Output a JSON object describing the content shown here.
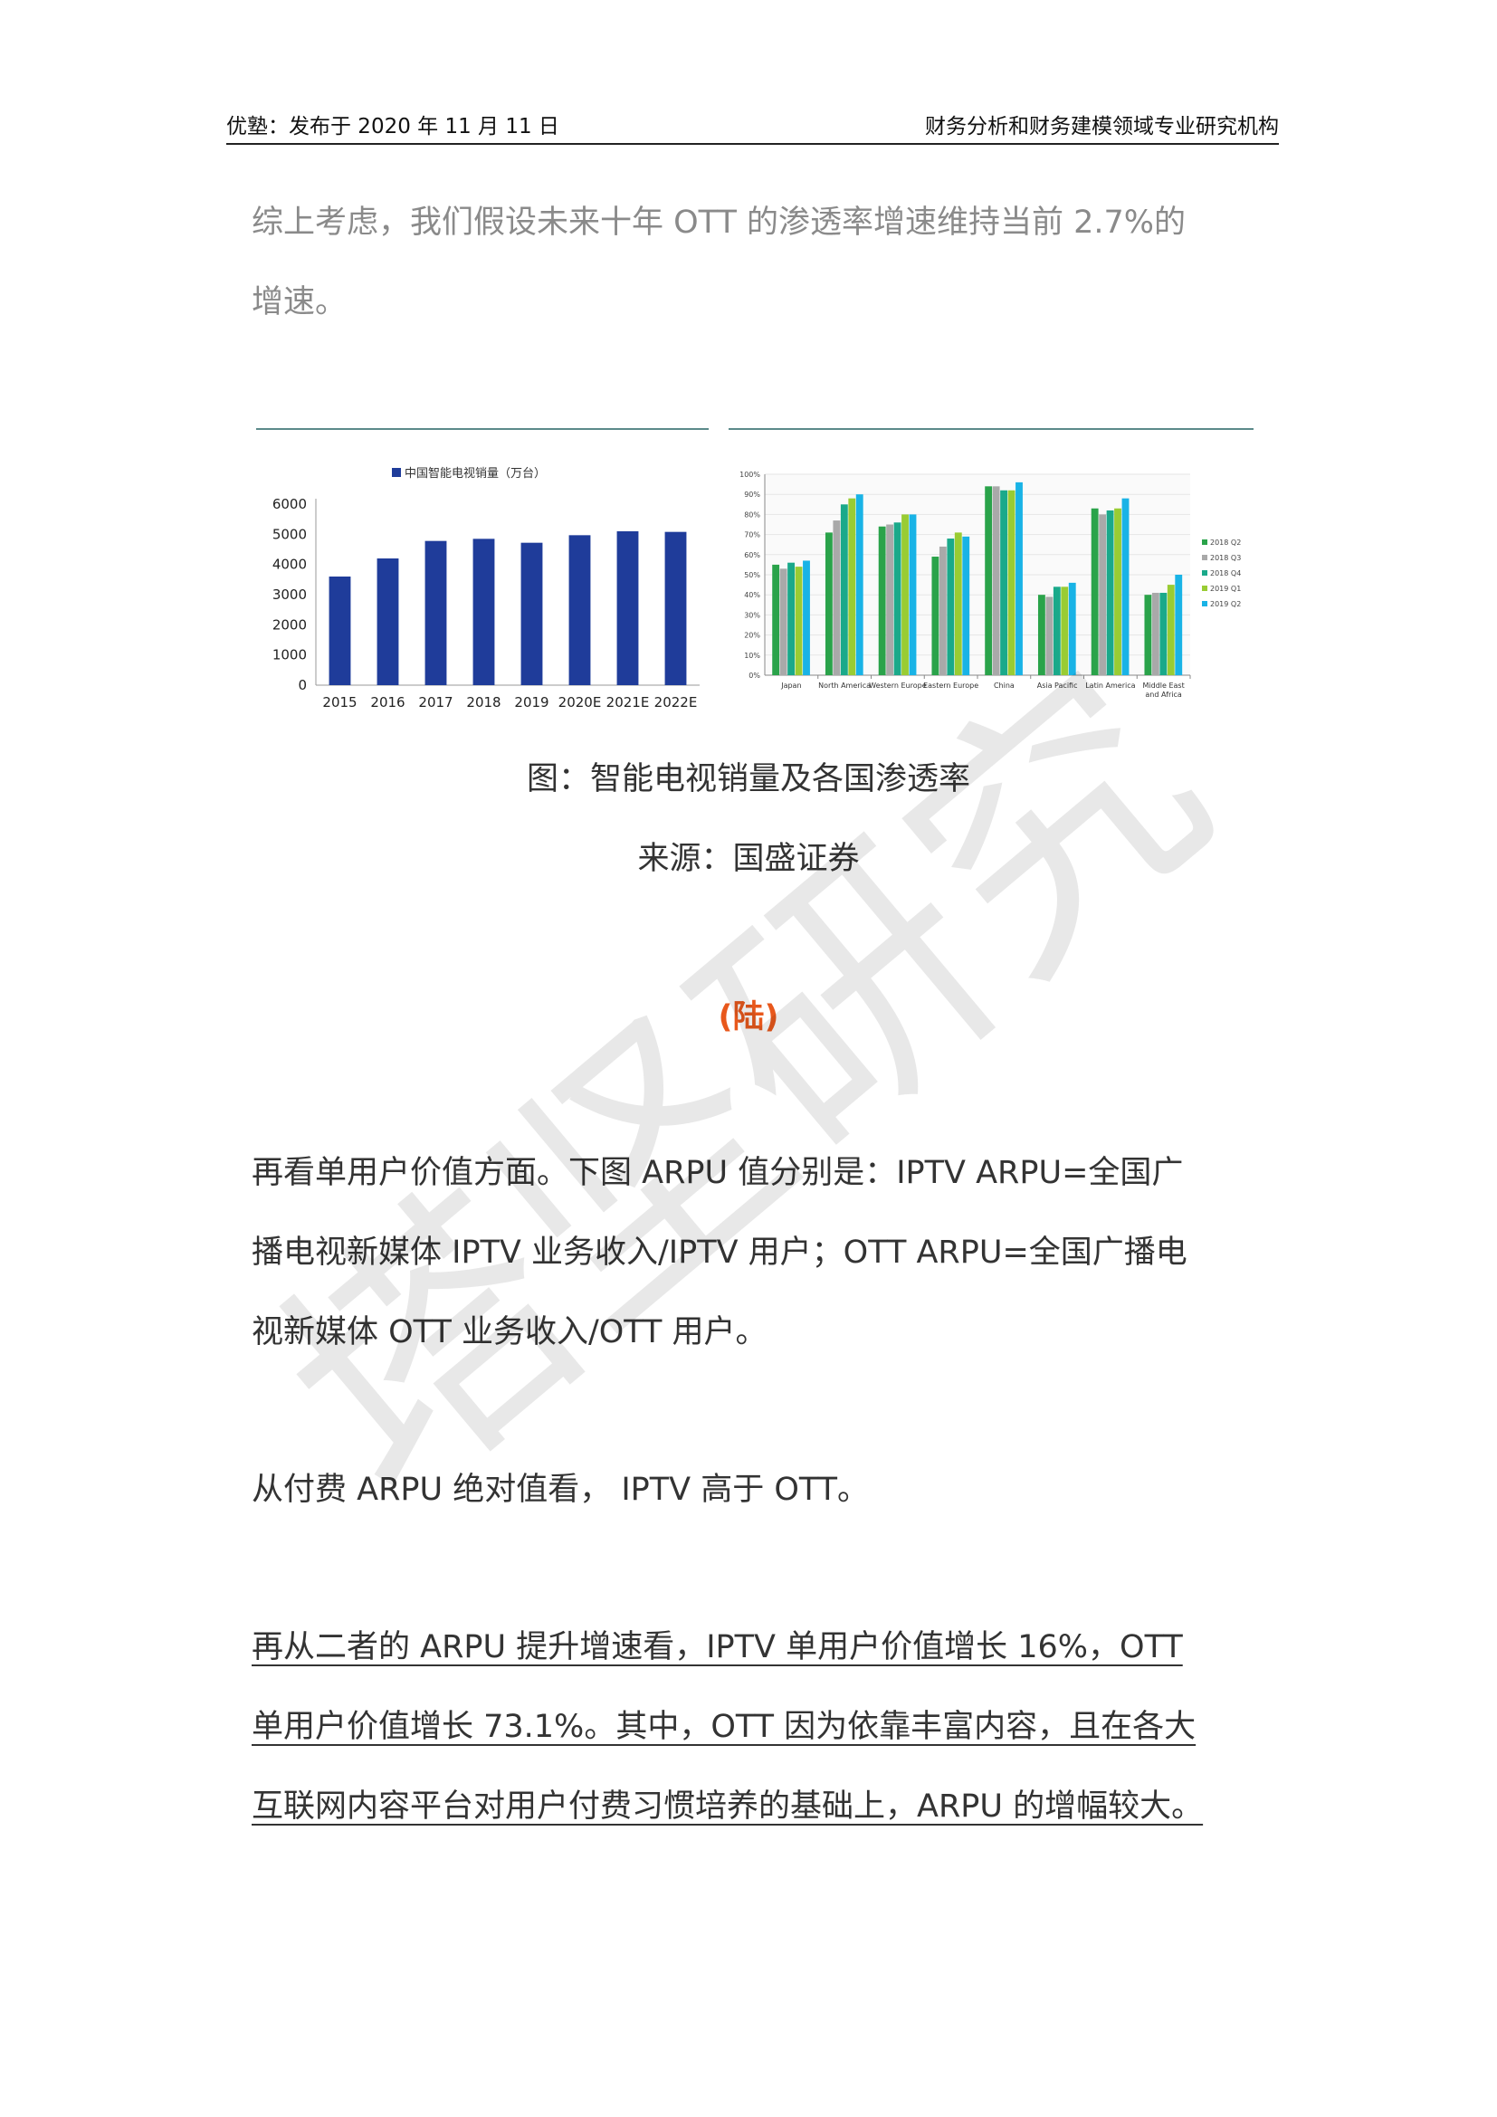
{
  "header": {
    "left": "优塾：发布于 2020 年 11 月 11 日",
    "right": "财务分析和财务建模领域专业研究机构"
  },
  "intro": {
    "line1": "综上考虑，我们假设未来十年 OTT 的渗透率增速维持当前 2.7%的",
    "line2": "增速。"
  },
  "figure": {
    "caption": "图：智能电视销量及各国渗透率",
    "source": "来源：国盛证券"
  },
  "section_mark": "(陆)",
  "paragraphs": {
    "p1_l1": "再看单用户价值方面。下图 ARPU 值分别是：IPTV ARPU=全国广",
    "p1_l2": "播电视新媒体 IPTV 业务收入/IPTV 用户；OTT ARPU=全国广播电",
    "p1_l3": "视新媒体 OTT 业务收入/OTT 用户。",
    "p2": "从付费 ARPU 绝对值看，  IPTV 高于 OTT。",
    "p3_l1": "再从二者的 ARPU 提升增速看，IPTV 单用户价值增长 16%，OTT",
    "p3_l2": "单用户价值增长 73.1%。其中，OTT 因为依靠丰富内容，且在各大",
    "p3_l3": "互联网内容平台对用户付费习惯培养的基础上，ARPU 的增幅较大。"
  },
  "watermark": "塔坚研究",
  "chart_data": [
    {
      "type": "bar",
      "title": "中国智能电视销量（万台）",
      "legend": [
        "中国智能电视销量（万台）"
      ],
      "categories": [
        "2015",
        "2016",
        "2017",
        "2018",
        "2019",
        "2020E",
        "2021E",
        "2022E"
      ],
      "values": [
        3600,
        4200,
        4780,
        4850,
        4720,
        4970,
        5100,
        5080
      ],
      "ylim": [
        0,
        6000
      ],
      "yticks": [
        "0",
        "1000",
        "2000",
        "3000",
        "4000",
        "5000",
        "6000"
      ],
      "color": "#1f3c9a",
      "legend_position": "top"
    },
    {
      "type": "bar",
      "categories": [
        "Japan",
        "North America",
        "Western Europe",
        "Eastern Europe",
        "China",
        "Asia Pacific",
        "Latin America",
        "Middle East and Africa"
      ],
      "series": [
        {
          "name": "2018 Q2",
          "color": "#2aa34a",
          "values": [
            55,
            71,
            74,
            59,
            94,
            40,
            83,
            40
          ]
        },
        {
          "name": "2018 Q3",
          "color": "#a9a9a9",
          "values": [
            53,
            77,
            75,
            64,
            94,
            39,
            80,
            41
          ]
        },
        {
          "name": "2018 Q4",
          "color": "#1aa98a",
          "values": [
            56,
            85,
            76,
            68,
            92,
            44,
            82,
            41
          ]
        },
        {
          "name": "2019 Q1",
          "color": "#99cc33",
          "values": [
            54,
            88,
            80,
            71,
            92,
            44,
            83,
            45
          ]
        },
        {
          "name": "2019 Q2",
          "color": "#19b3e6",
          "values": [
            57,
            90,
            80,
            69,
            96,
            46,
            88,
            50
          ]
        }
      ],
      "ylim": [
        0,
        100
      ],
      "yticks": [
        "0%",
        "10%",
        "20%",
        "30%",
        "40%",
        "50%",
        "60%",
        "70%",
        "80%",
        "90%",
        "100%"
      ],
      "legend_position": "right"
    }
  ]
}
